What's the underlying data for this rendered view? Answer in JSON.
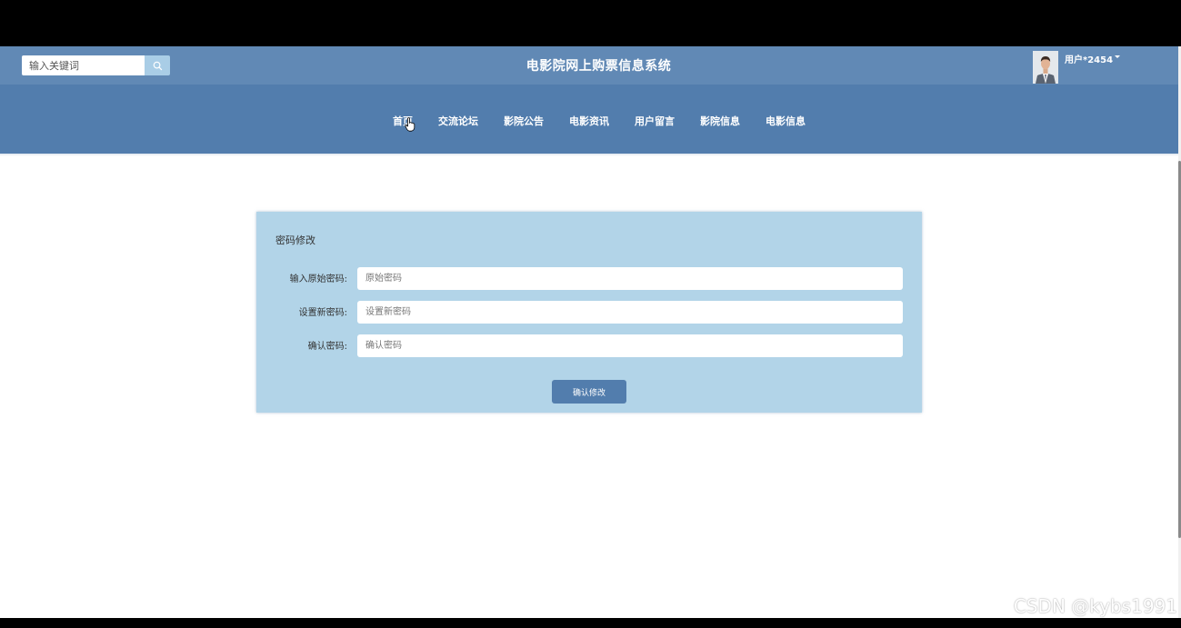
{
  "header": {
    "search": {
      "placeholder": "输入关键词"
    },
    "site_title": "电影院网上购票信息系统",
    "user": {
      "name": "用户*2454"
    }
  },
  "nav": {
    "items": [
      {
        "label": "首页"
      },
      {
        "label": "交流论坛"
      },
      {
        "label": "影院公告"
      },
      {
        "label": "电影资讯"
      },
      {
        "label": "用户留言"
      },
      {
        "label": "影院信息"
      },
      {
        "label": "电影信息"
      }
    ]
  },
  "form": {
    "title": "密码修改",
    "fields": [
      {
        "label": "输入原始密码:",
        "placeholder": "原始密码",
        "value": ""
      },
      {
        "label": "设置新密码:",
        "placeholder": "设置新密码",
        "value": ""
      },
      {
        "label": "确认密码:",
        "placeholder": "确认密码",
        "value": ""
      }
    ],
    "submit_label": "确认修改"
  },
  "watermark": "CSDN @kybs1991",
  "colors": {
    "topbar": "#6189b5",
    "navbar": "#527dad",
    "panel": "#b2d4e8",
    "button": "#527dad",
    "search_button": "#a9cde6"
  },
  "icons": {
    "search_button": "search-icon",
    "user_menu": "caret-down-icon",
    "pointer": "hand-pointer-icon"
  }
}
